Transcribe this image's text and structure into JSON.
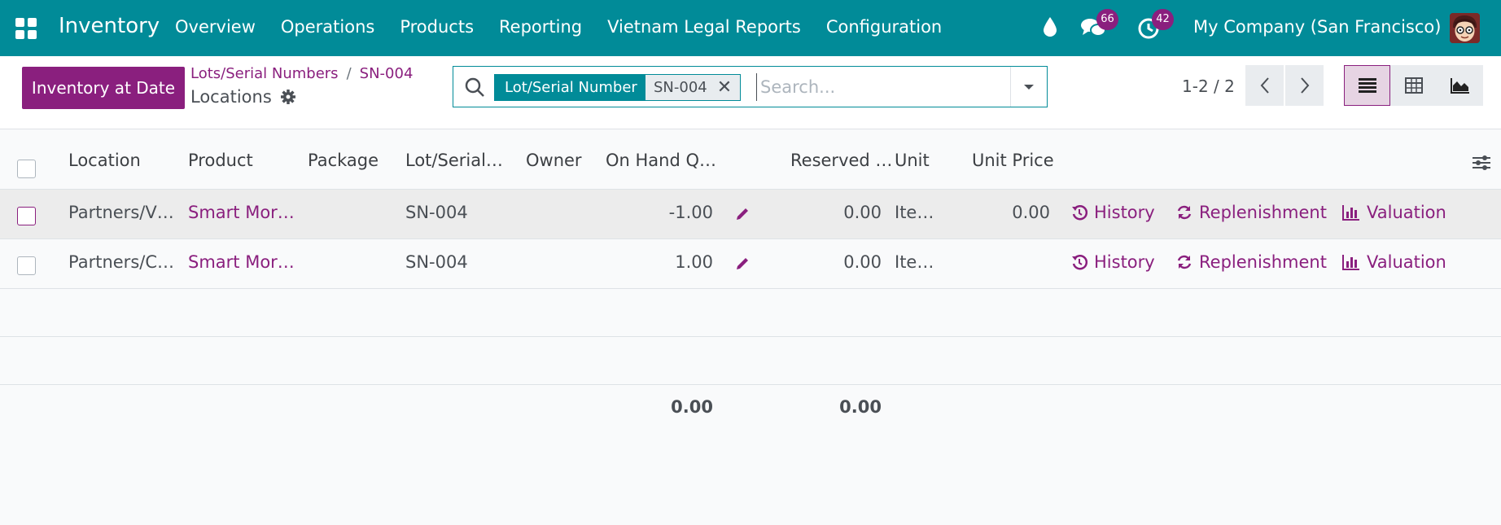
{
  "navbar": {
    "app_name": "Inventory",
    "menu": [
      "Overview",
      "Operations",
      "Products",
      "Reporting",
      "Vietnam Legal Reports",
      "Configuration"
    ],
    "messages_count": "66",
    "activities_count": "42",
    "company": "My Company (San Francisco)"
  },
  "control": {
    "primary_button": "Inventory at Date",
    "breadcrumb": [
      "Lots/Serial Numbers",
      "SN-004"
    ],
    "title": "Locations",
    "search": {
      "facet_label": "Lot/Serial Number",
      "facet_value": "SN-004",
      "placeholder": "Search..."
    },
    "pager": "1-2 / 2"
  },
  "table": {
    "columns": [
      "Location",
      "Product",
      "Package",
      "Lot/Serial…",
      "Owner",
      "On Hand Q…",
      "Reserved …",
      "Unit",
      "Unit Price"
    ],
    "rows": [
      {
        "location": "Partners/V…",
        "product": "Smart Mor…",
        "package": "",
        "lot": "SN-004",
        "owner": "",
        "on_hand": "-1.00",
        "reserved": "0.00",
        "unit": "Ite…",
        "unit_price": "0.00"
      },
      {
        "location": "Partners/C…",
        "product": "Smart Mor…",
        "package": "",
        "lot": "SN-004",
        "owner": "",
        "on_hand": "1.00",
        "reserved": "0.00",
        "unit": "Ite…",
        "unit_price": ""
      }
    ],
    "actions": {
      "history": "History",
      "replenishment": "Replenishment",
      "valuation": "Valuation"
    },
    "totals": {
      "on_hand": "0.00",
      "reserved": "0.00"
    }
  },
  "colors": {
    "navbar": "#018b98",
    "primary": "#8a1f7e"
  }
}
